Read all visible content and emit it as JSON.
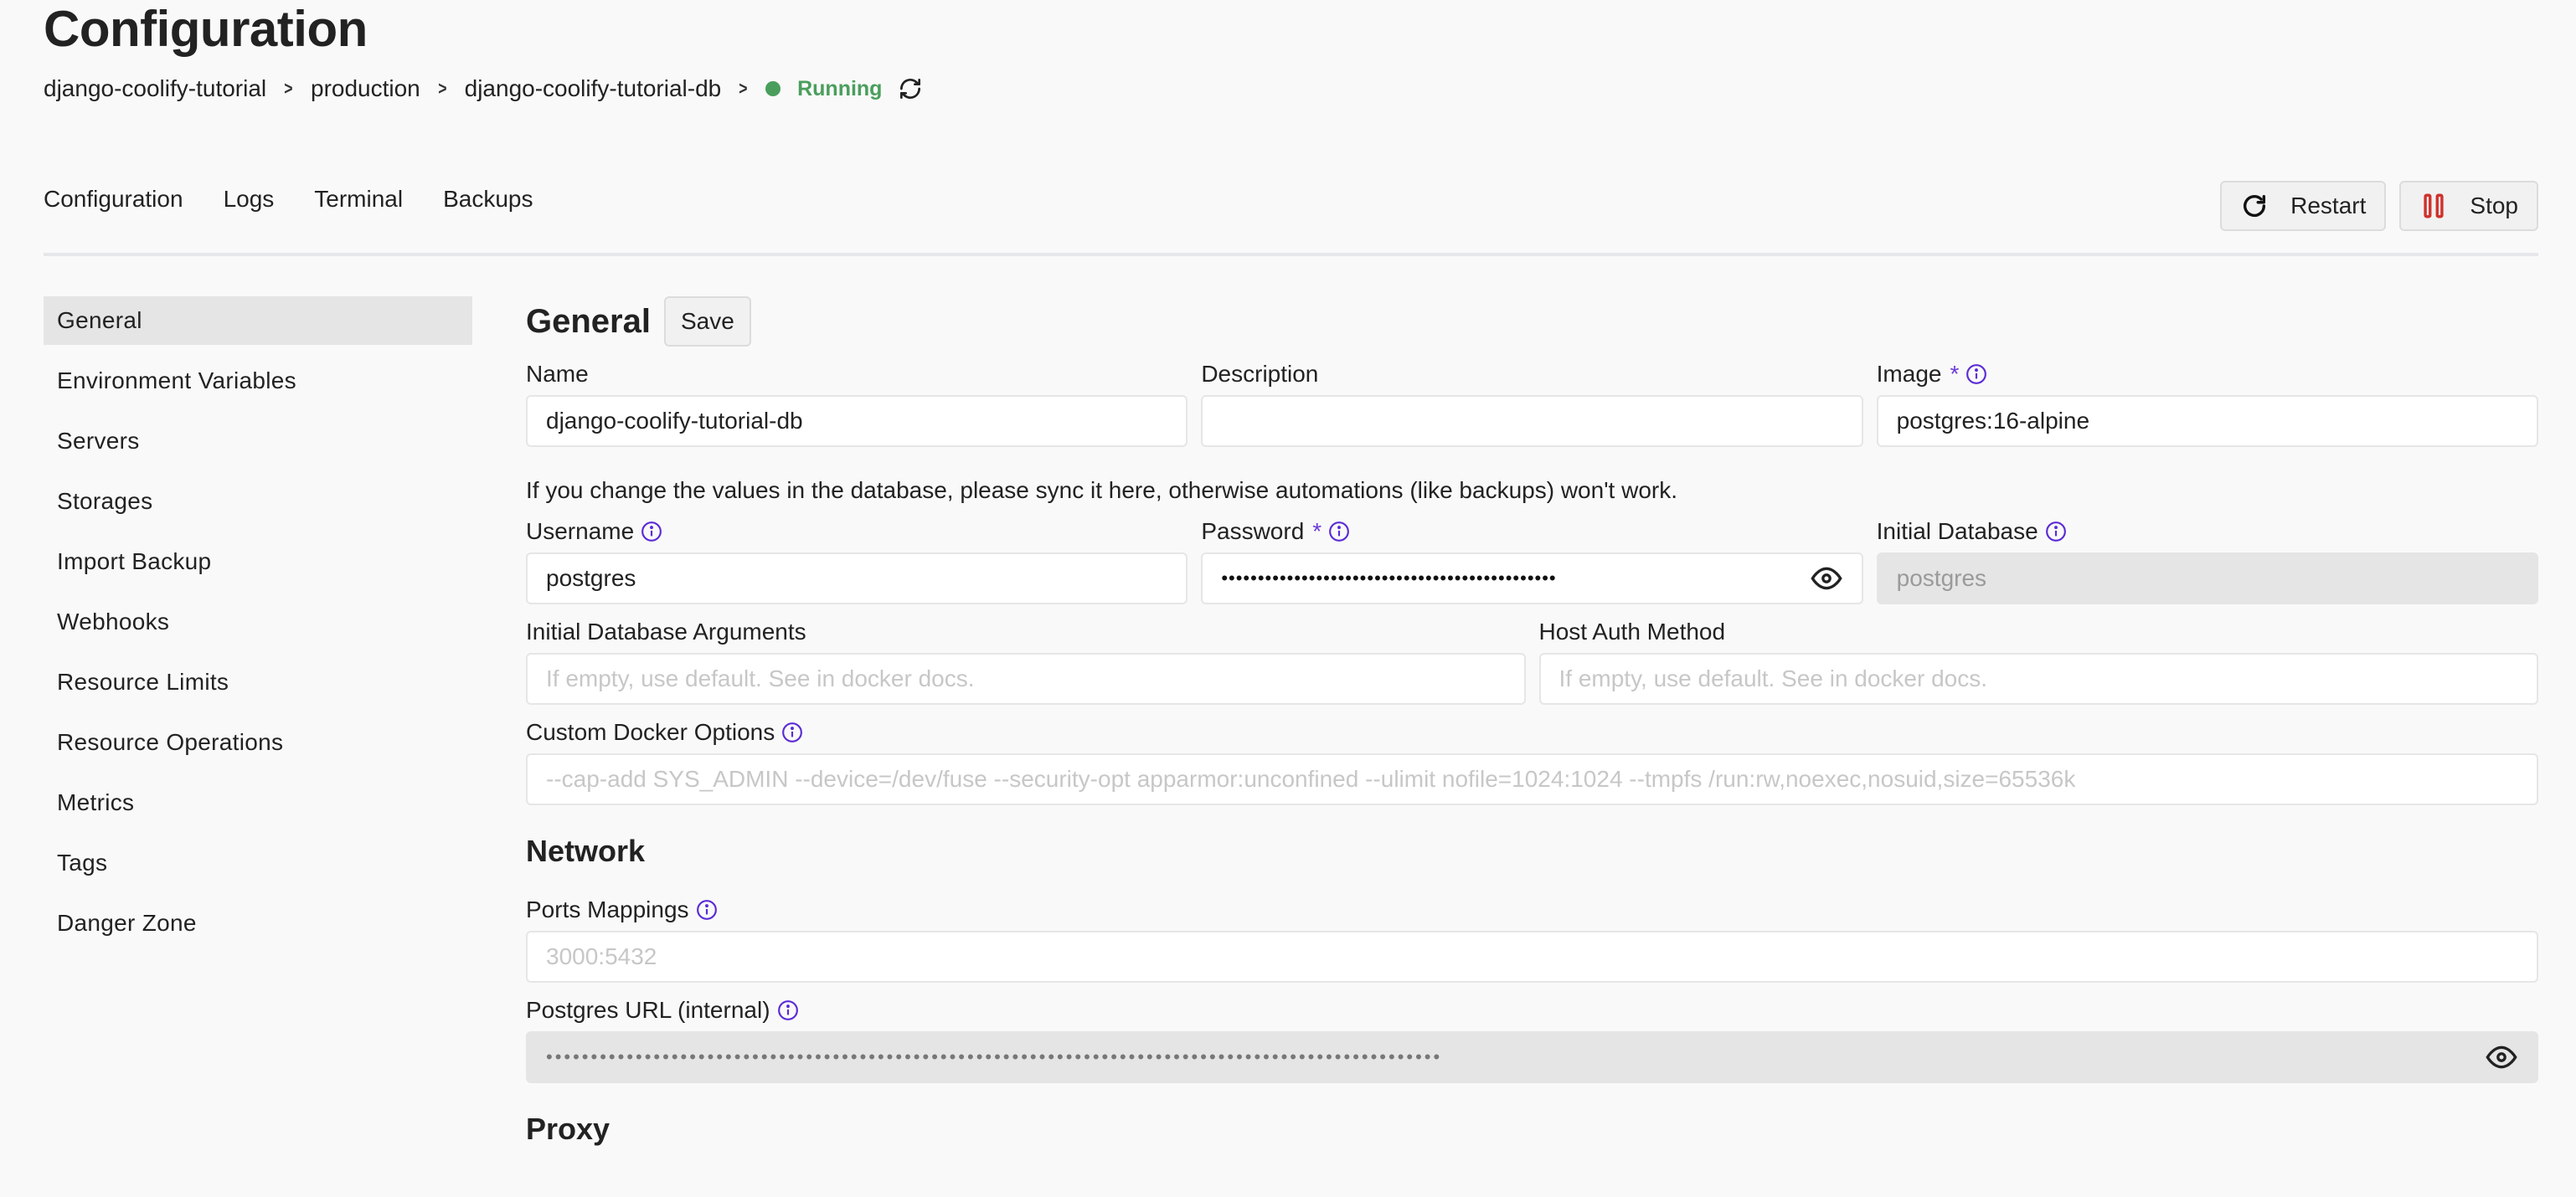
{
  "header": {
    "title": "Configuration",
    "breadcrumb": [
      "django-coolify-tutorial",
      "production",
      "django-coolify-tutorial-db"
    ],
    "status": "Running",
    "status_color": "#4a9e5c"
  },
  "tabs": [
    "Configuration",
    "Logs",
    "Terminal",
    "Backups"
  ],
  "actions": {
    "restart_label": "Restart",
    "stop_label": "Stop",
    "stop_icon_color": "#d0312d"
  },
  "sidebar": {
    "items": [
      {
        "label": "General",
        "active": true
      },
      {
        "label": "Environment Variables"
      },
      {
        "label": "Servers"
      },
      {
        "label": "Storages"
      },
      {
        "label": "Import Backup"
      },
      {
        "label": "Webhooks"
      },
      {
        "label": "Resource Limits"
      },
      {
        "label": "Resource Operations"
      },
      {
        "label": "Metrics"
      },
      {
        "label": "Tags"
      },
      {
        "label": "Danger Zone"
      }
    ]
  },
  "general": {
    "title": "General",
    "save_label": "Save",
    "name": {
      "label": "Name",
      "value": "django-coolify-tutorial-db"
    },
    "description": {
      "label": "Description",
      "value": ""
    },
    "image": {
      "label": "Image",
      "required": "*",
      "value": "postgres:16-alpine"
    },
    "help_text": "If you change the values in the database, please sync it here, otherwise automations (like backups) won't work.",
    "username": {
      "label": "Username",
      "value": "postgres"
    },
    "password": {
      "label": "Password",
      "required": "*",
      "masked_value": "••••••••••••••••••••••••••••••••••••••••••••••"
    },
    "initial_database": {
      "label": "Initial Database",
      "value": "postgres"
    },
    "initial_db_args": {
      "label": "Initial Database Arguments",
      "placeholder": "If empty, use default. See in docker docs."
    },
    "host_auth_method": {
      "label": "Host Auth Method",
      "placeholder": "If empty, use default. See in docker docs."
    },
    "custom_docker_options": {
      "label": "Custom Docker Options",
      "placeholder": "--cap-add SYS_ADMIN --device=/dev/fuse --security-opt apparmor:unconfined --ulimit nofile=1024:1024 --tmpfs /run:rw,noexec,nosuid,size=65536k"
    }
  },
  "network": {
    "title": "Network",
    "ports_mappings": {
      "label": "Ports Mappings",
      "placeholder": "3000:5432"
    },
    "postgres_url": {
      "label": "Postgres URL (internal)",
      "masked_value": "••••••••••••••••••••••••••••••••••••••••••••••••••••••••••••••••••••••••••••••••••••••••••••••••••••"
    }
  },
  "proxy": {
    "title": "Proxy"
  },
  "colors": {
    "accent": "#6b3bd9",
    "info_icon": "#5b2bd6"
  }
}
